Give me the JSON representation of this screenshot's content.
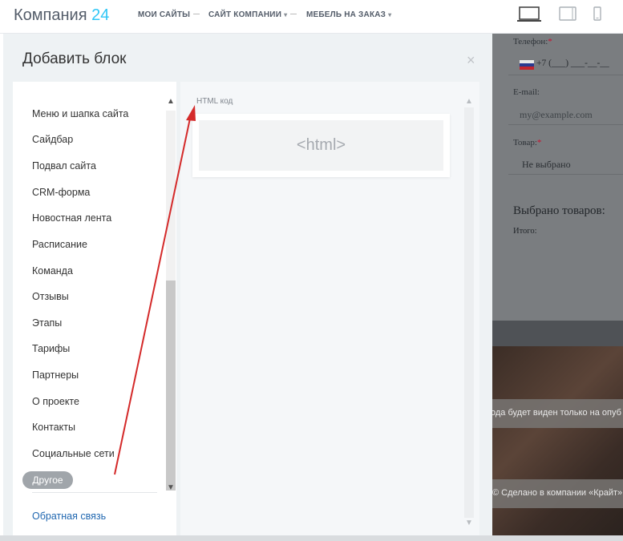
{
  "header": {
    "logo_text": "Компания",
    "logo_number": "24",
    "nav": [
      "МОИ САЙТЫ",
      "САЙТ КОМПАНИИ",
      "МЕБЕЛЬ НА ЗАКАЗ"
    ],
    "devices": [
      "laptop-icon",
      "tablet-icon",
      "phone-icon"
    ]
  },
  "dialog": {
    "title": "Добавить блок",
    "close_glyph": "×",
    "categories": [
      "Меню и шапка сайта",
      "Сайдбар",
      "Подвал сайта",
      "CRM-форма",
      "Новостная лента",
      "Расписание",
      "Команда",
      "Отзывы",
      "Этапы",
      "Тарифы",
      "Партнеры",
      "О проекте",
      "Контакты",
      "Социальные сети"
    ],
    "active_category": "Другое",
    "feedback_link": "Обратная связь",
    "block_label": "HTML код",
    "block_preview_text": "<html>"
  },
  "preview": {
    "phone_label": "Телефон:",
    "required_mark": "*",
    "phone_value": "+7 (___) ___-__-__",
    "email_label": "E-mail:",
    "email_placeholder": "my@example.com",
    "product_label": "Товар:",
    "product_value": "Не выбрано",
    "selected_heading": "Выбрано товаров:",
    "total_label": "Итого:",
    "notice_text": "ода будет виден только на опуб",
    "footer_text": "© Сделано в компании «Крайт»"
  },
  "colors": {
    "accent": "#2fc6f6",
    "link": "#2067b0",
    "annotation_arrow": "#d42a2a",
    "required": "#c8102e"
  }
}
